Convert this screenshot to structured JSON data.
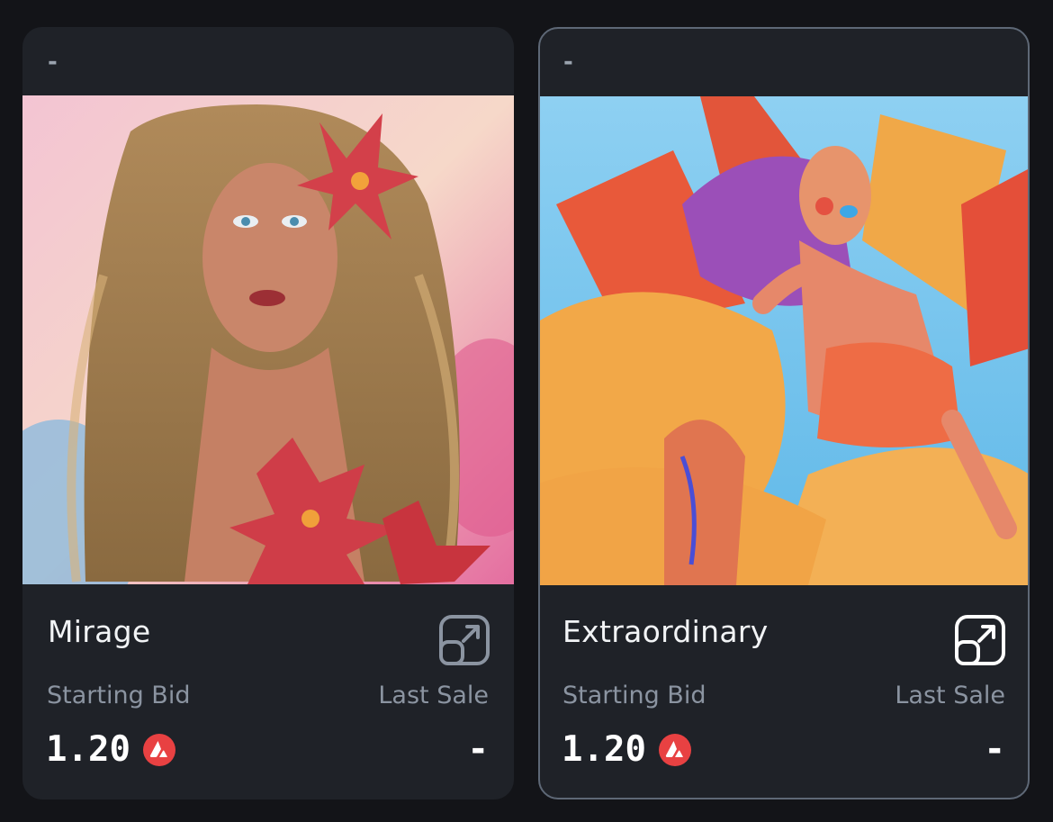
{
  "cards": [
    {
      "top_label": "-",
      "title": "Mirage",
      "starting_bid_label": "Starting Bid",
      "last_sale_label": "Last Sale",
      "starting_bid": "1.20",
      "last_sale": "-",
      "currency_icon": "avax-icon",
      "action_icon": "external-link-icon",
      "selected": false
    },
    {
      "top_label": "-",
      "title": "Extraordinary",
      "starting_bid_label": "Starting Bid",
      "last_sale_label": "Last Sale",
      "starting_bid": "1.20",
      "last_sale": "-",
      "currency_icon": "avax-icon",
      "action_icon": "external-link-icon",
      "selected": true
    }
  ],
  "colors": {
    "background": "#131418",
    "card": "#1f2228",
    "selected_border": "#5e6876",
    "avax_red": "#e84142",
    "muted_text": "#8b94a1"
  }
}
